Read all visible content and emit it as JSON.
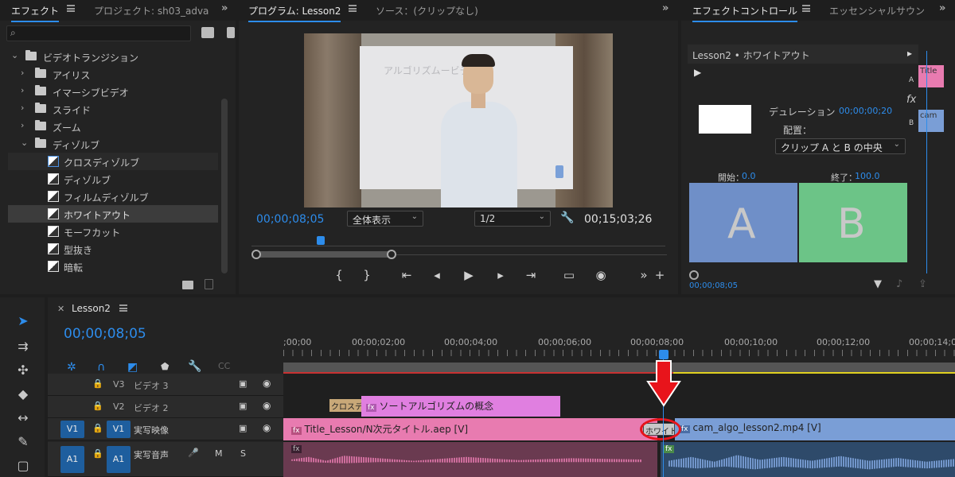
{
  "effects_panel": {
    "tabs": [
      "エフェクト",
      "プロジェクト: sh03_adva"
    ],
    "search_placeholder": "",
    "tree": [
      {
        "label": "ビデオトランジション",
        "type": "folder-open"
      },
      {
        "label": "アイリス",
        "type": "folder"
      },
      {
        "label": "イマーシブビデオ",
        "type": "folder"
      },
      {
        "label": "スライド",
        "type": "folder"
      },
      {
        "label": "ズーム",
        "type": "folder"
      },
      {
        "label": "ディゾルブ",
        "type": "folder-open"
      },
      {
        "label": "クロスディゾルブ",
        "type": "effect"
      },
      {
        "label": "ディゾルブ",
        "type": "effect"
      },
      {
        "label": "フィルムディゾルブ",
        "type": "effect"
      },
      {
        "label": "ホワイトアウト",
        "type": "effect"
      },
      {
        "label": "モーフカット",
        "type": "effect"
      },
      {
        "label": "型抜き",
        "type": "effect"
      },
      {
        "label": "暗転",
        "type": "effect"
      }
    ]
  },
  "program_monitor": {
    "tabs": [
      "プログラム: Lesson2",
      "ソース：(クリップなし)"
    ],
    "video_caption": "アルゴリズムービデオ",
    "timecode": "00;00;08;05",
    "zoom": "全体表示",
    "resolution": "1/2",
    "duration": "00;15;03;26"
  },
  "effect_controls": {
    "tabs": [
      "エフェクトコントロール",
      "エッセンシャルサウン"
    ],
    "header": "Lesson2 • ホワイトアウト",
    "duration_label": "デュレーション",
    "duration_value": "00;00;00;20",
    "alignment_label": "配置：",
    "alignment_value": "クリップ A と B の中央",
    "start_label": "開始：",
    "start_value": "0.0",
    "end_label": "終了：",
    "end_value": "100.0",
    "a_label": "A",
    "b_label": "B",
    "side_a": "A",
    "side_b": "B",
    "side_title": "Title",
    "side_cam": "cam",
    "footer_timecode": "00;00;08;05",
    "fx_label": "fx"
  },
  "timeline": {
    "sequence_name": "Lesson2",
    "timecode": "00;00;08;05",
    "ruler": [
      ";00;00",
      "00;00;02;00",
      "00;00;04;00",
      "00;00;06;00",
      "00;00;08;00",
      "00;00;10;00",
      "00;00;12;00",
      "00;00;14;0"
    ],
    "tracks": [
      {
        "id": "V3",
        "name": "ビデオ 3"
      },
      {
        "id": "V2",
        "name": "ビデオ 2"
      },
      {
        "id": "V1",
        "name": "実写映像",
        "src": "V1"
      },
      {
        "id": "A1",
        "name": "実写音声",
        "src": "A1"
      }
    ],
    "mute_label": "M",
    "solo_label": "S",
    "clips": {
      "v2_transition": "クロスデ",
      "v2_title": "ソートアルゴリズムの概念",
      "v1_title": "Title_Lesson/N次元タイトル.aep [V]",
      "v1_transition": "ホワイト",
      "v1_cam": "cam_algo_lesson2.mp4 [V]"
    }
  },
  "colors": {
    "accent": "#2d8ceb",
    "clip_pink": "#e87bb0",
    "clip_v2": "#e07fe0",
    "clip_cam": "#7a9ed6",
    "annotation_red": "#e8141b"
  }
}
